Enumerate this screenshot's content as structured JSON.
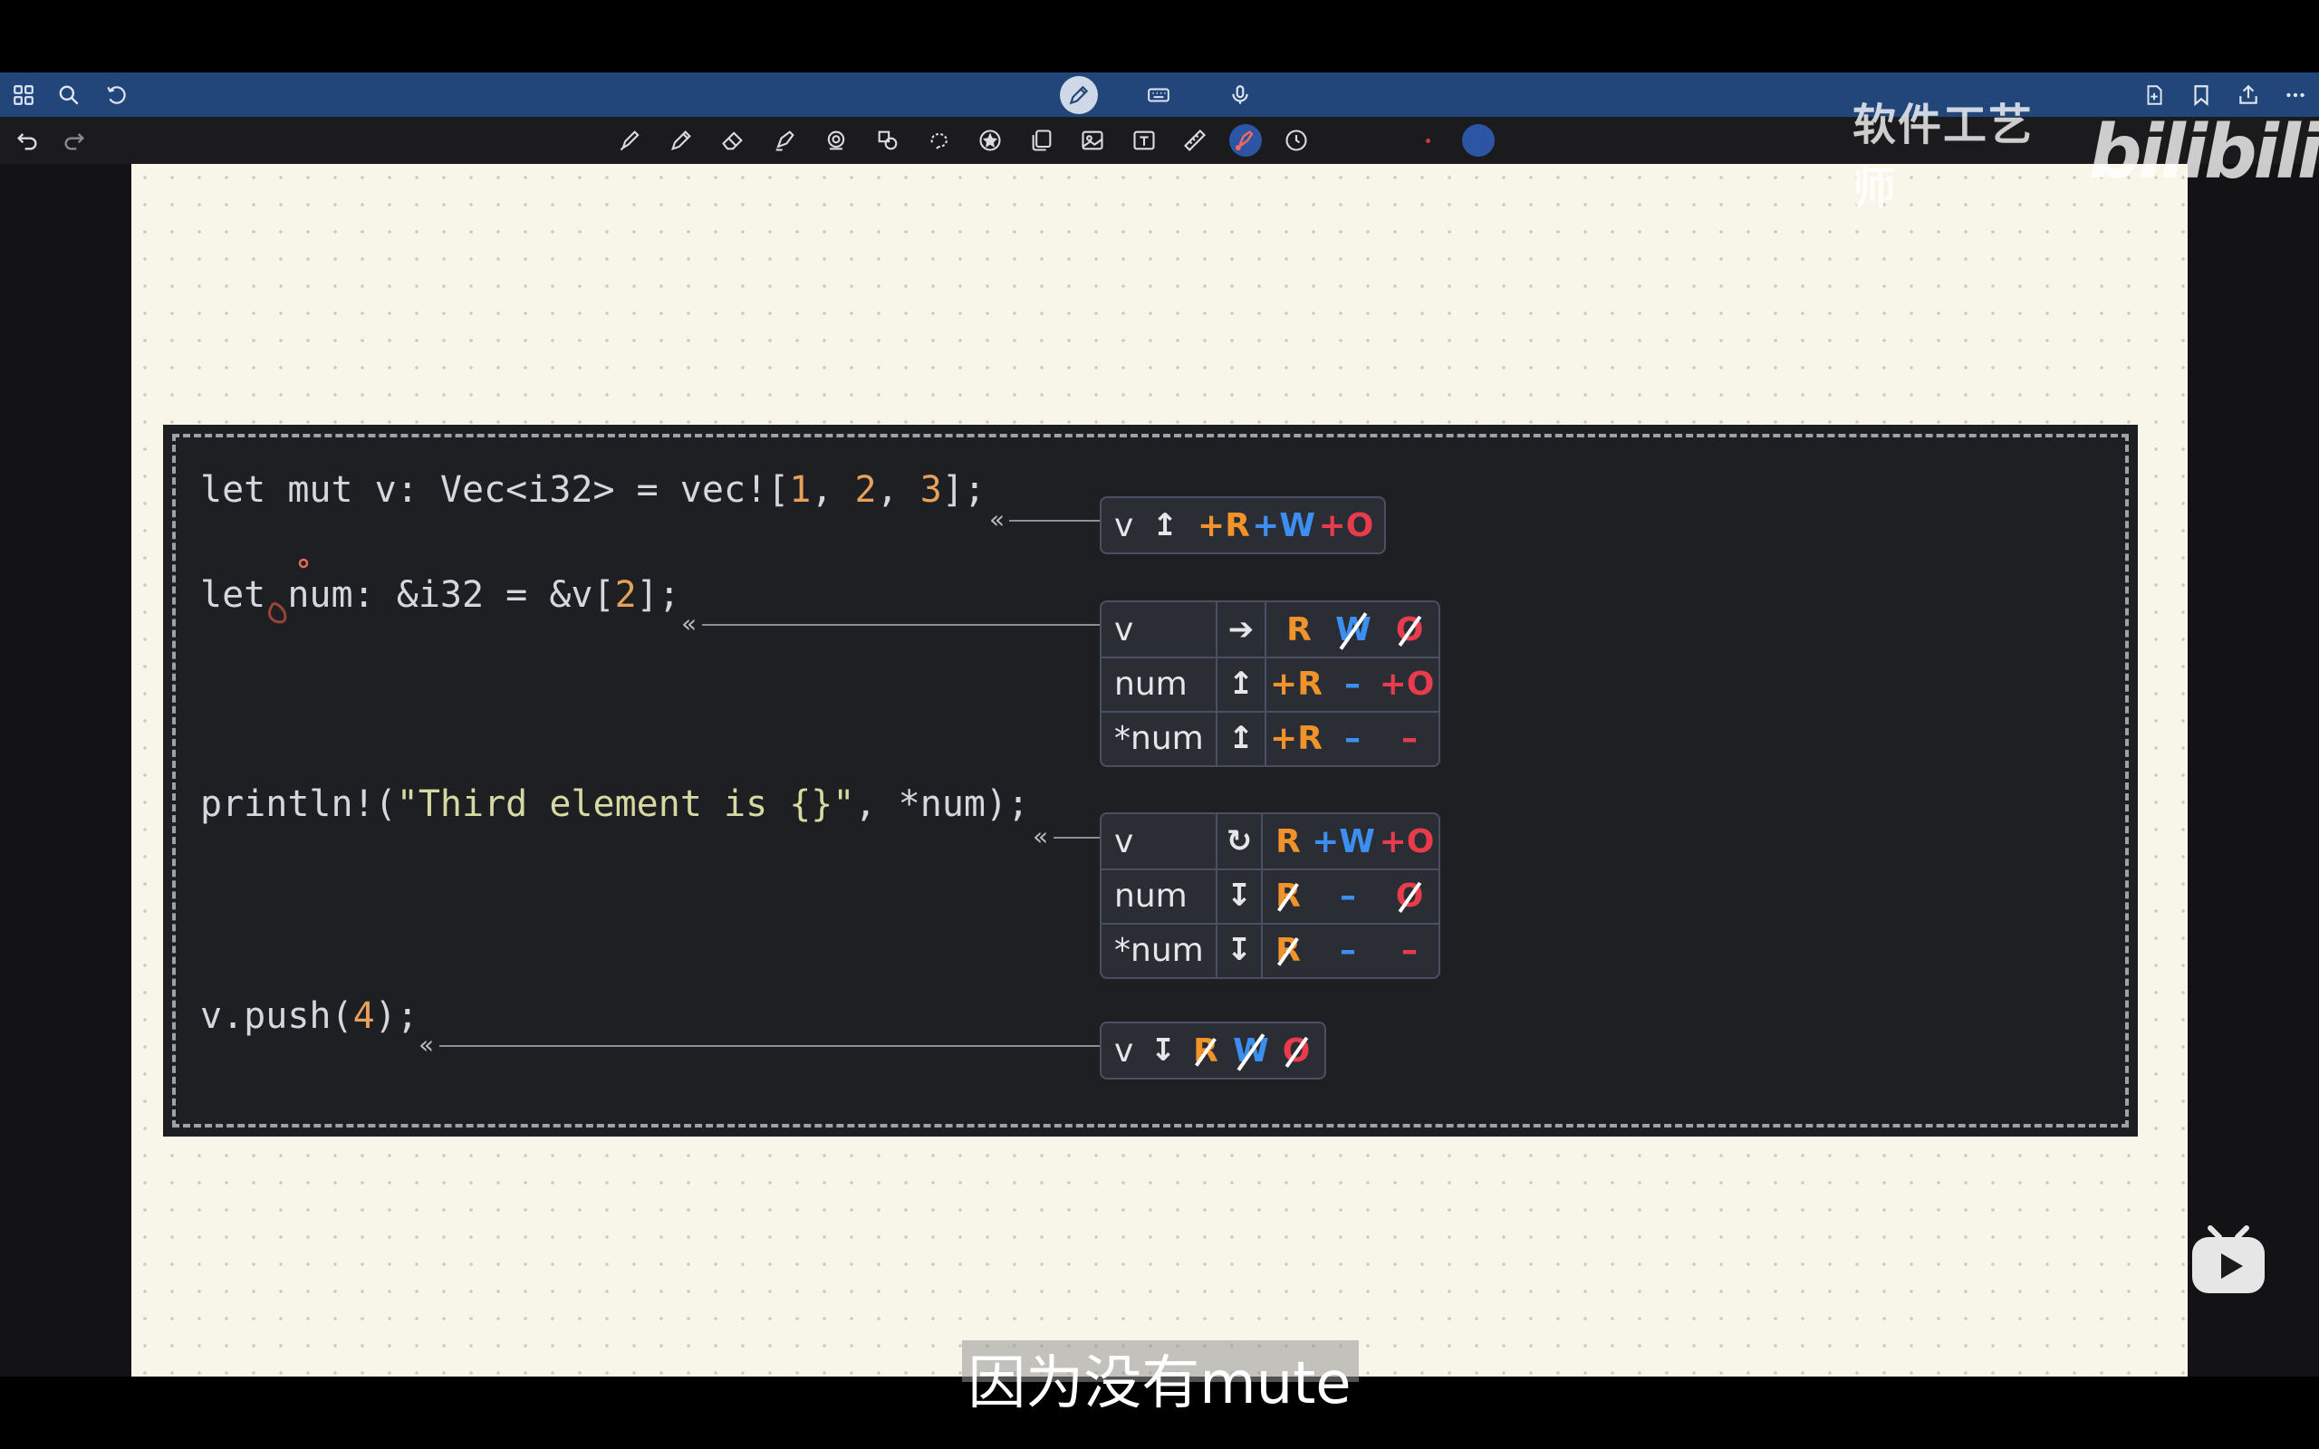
{
  "topbar": {
    "left_icons": [
      "grid-icon",
      "search-icon",
      "refresh-icon"
    ],
    "center_icons": [
      "pencil-icon",
      "keyboard-icon",
      "microphone-icon"
    ],
    "right_icons": [
      "add-page-icon",
      "bookmark-icon",
      "share-icon",
      "more-icon"
    ]
  },
  "toolbar": {
    "history_icons": [
      "undo-icon",
      "redo-icon"
    ],
    "tools": [
      "pen-icon",
      "pencil-icon",
      "eraser-icon",
      "highlighter-icon",
      "lasso-icon",
      "shapes-icon",
      "loop-icon",
      "star-icon",
      "sticker-icon",
      "image-icon",
      "text-icon",
      "ruler-icon",
      "laser-pointer-icon",
      "clock-icon"
    ],
    "active_tool": "laser-pointer-icon",
    "accent": "#2c56a4"
  },
  "watermark": {
    "text": "软件工艺师",
    "logo": "bilibili"
  },
  "code": {
    "line1": {
      "a": "let mut v: Vec<i32> = vec![",
      "n1": "1",
      "c1": ", ",
      "n2": "2",
      "c2": ", ",
      "n3": "3",
      "b": "];"
    },
    "line2": {
      "a": "let num: &i32 = &v[",
      "n1": "2",
      "b": "];"
    },
    "line3": {
      "a": "println!(",
      "s": "\"Third element is {}\"",
      "b": ", *num);"
    },
    "line4": {
      "a": "v.push(",
      "n1": "4",
      "b": ");"
    }
  },
  "leader_glyph": "«",
  "tables": {
    "t1": {
      "rows": [
        {
          "label": "v",
          "arrow": "↥",
          "r": "+R",
          "w": "+W",
          "o": "+O"
        }
      ]
    },
    "t2": {
      "rows": [
        {
          "label": "v",
          "arrow": "➔",
          "r": "R",
          "w": "W",
          "o": "O"
        },
        {
          "label": "num",
          "arrow": "↥",
          "r": "+R",
          "w": "–",
          "o": "+O"
        },
        {
          "label": "*num",
          "arrow": "↥",
          "r": "+R",
          "w": "–",
          "o": "–"
        }
      ]
    },
    "t3": {
      "rows": [
        {
          "label": "v",
          "arrow": "↻",
          "r": "R",
          "w": "+W",
          "o": "+O"
        },
        {
          "label": "num",
          "arrow": "↧",
          "r": "R",
          "w": "–",
          "o": "O"
        },
        {
          "label": "*num",
          "arrow": "↧",
          "r": "R",
          "w": "–",
          "o": "–"
        }
      ]
    },
    "t4": {
      "rows": [
        {
          "label": "v",
          "arrow": "↧",
          "r": "R",
          "w": "W",
          "o": "O"
        }
      ]
    }
  },
  "colors": {
    "read": "#f0932b",
    "write": "#3c8ef0",
    "own": "#e83c4c",
    "card_bg": "#1e1f22",
    "canvas": "#f8f6e8"
  },
  "subtitle": "因为没有mute"
}
